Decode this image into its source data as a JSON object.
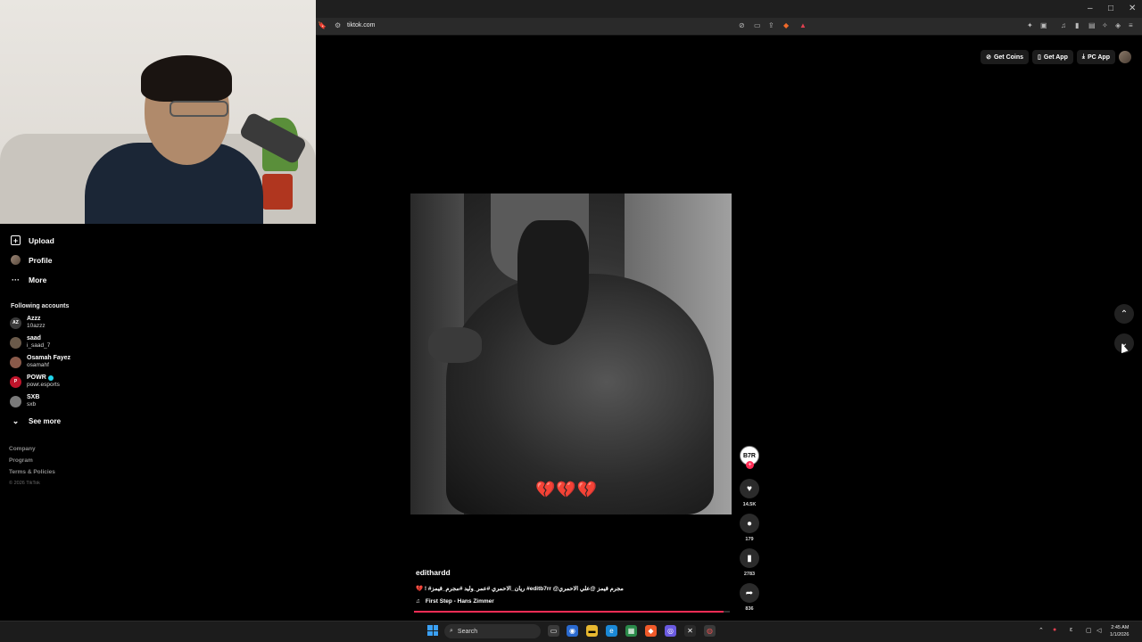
{
  "browser": {
    "url": "tiktok.com",
    "window_controls": [
      "–",
      "□",
      "✕"
    ]
  },
  "header": {
    "get_coins": "Get Coins",
    "get_app": "Get App",
    "pc_app": "PC App"
  },
  "sidebar": {
    "nav": [
      {
        "label": "Upload",
        "icon": "upload-icon"
      },
      {
        "label": "Profile",
        "icon": "profile-icon"
      },
      {
        "label": "More",
        "icon": "more-icon"
      }
    ],
    "following_title": "Following accounts",
    "accounts": [
      {
        "name": "Azzz",
        "handle": "10azzz",
        "verified": false,
        "avatar_color": "#3a3a3a",
        "avatar_text": "AZ"
      },
      {
        "name": "saad",
        "handle": "i_saad_7",
        "verified": false,
        "avatar_color": "#6a5a4a",
        "avatar_text": ""
      },
      {
        "name": "Osamah Fayez",
        "handle": "osamahf",
        "verified": false,
        "avatar_color": "#8a5a4a",
        "avatar_text": ""
      },
      {
        "name": "POWR",
        "handle": "powr.esports",
        "verified": true,
        "avatar_color": "#c0142b",
        "avatar_text": "P"
      },
      {
        "name": "SXB",
        "handle": "sxb",
        "verified": false,
        "avatar_color": "#7a7a7a",
        "avatar_text": ""
      }
    ],
    "see_more": "See more",
    "footer": [
      "Company",
      "Program",
      "Terms & Policies"
    ],
    "copyright": "© 2026 TikTok"
  },
  "video": {
    "creator_avatar_text": "B7R",
    "emoji_overlay": "💔💔💔",
    "likes": "14.5K",
    "comments": "179",
    "saves": "2783",
    "shares": "836",
    "username": "edithardd",
    "caption": "💔 ! #ريان_الاحمري #عمر_وليد #مجرم_قيمز #editb7rr @مجرم قيمز @علي الاحمري",
    "music": "First Step - Hans Zimmer",
    "progress": 0.98
  },
  "taskbar": {
    "search_placeholder": "Search",
    "time": "2:45 AM",
    "date": "1/1/2026"
  },
  "colors": {
    "accent": "#fe2c55",
    "verified": "#20d5ec",
    "start": "#3aa0f5"
  }
}
